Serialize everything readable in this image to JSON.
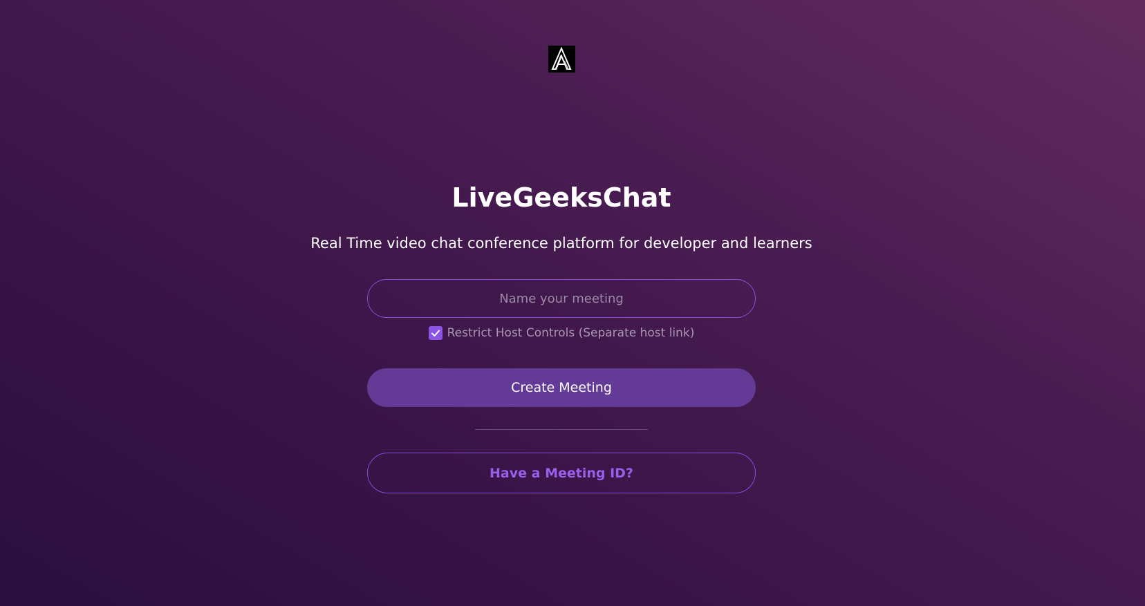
{
  "logo": {
    "icon": "stylized-a-logo-icon",
    "background": "#000000"
  },
  "app": {
    "title": "LiveGeeksChat",
    "subtitle": "Real Time video chat conference platform for developer and learners"
  },
  "form": {
    "meeting_name": {
      "value": "",
      "placeholder": "Name your meeting"
    },
    "restrict_host": {
      "checked": true,
      "label": "Restrict Host Controls (Separate host link)"
    },
    "create_label": "Create Meeting",
    "join_label": "Have a Meeting ID?"
  },
  "colors": {
    "accent": "#8c54e6",
    "primary_button": "#633a96",
    "link_text": "#9a5ee8",
    "background_start": "#2a0e40",
    "background_end": "#622b5e"
  }
}
